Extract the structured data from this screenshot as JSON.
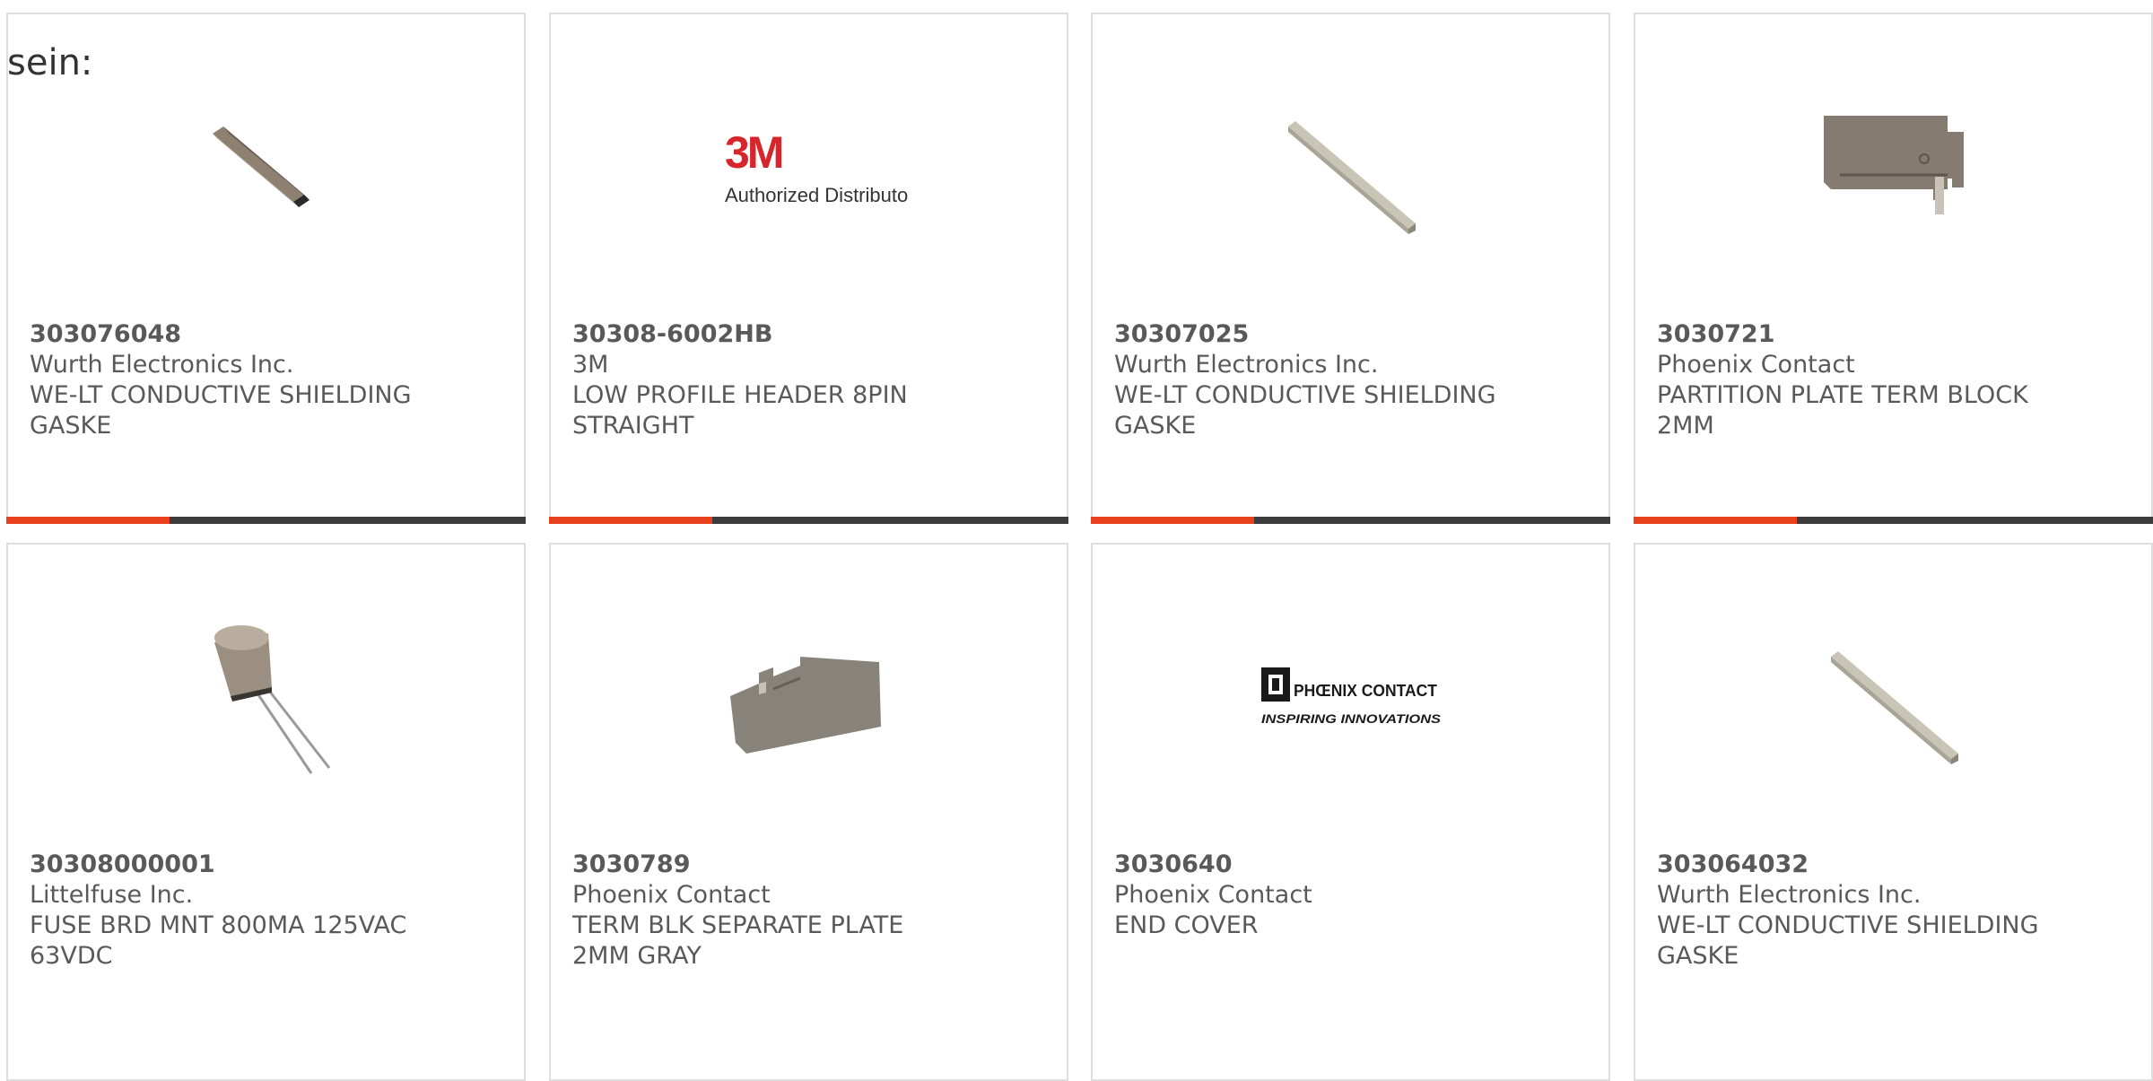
{
  "intro_text": "sein:",
  "products": [
    {
      "part_number": "303076048",
      "manufacturer": "Wurth Electronics Inc.",
      "description": "WE-LT CONDUCTIVE SHIELDING GASKE",
      "image": "gasket-block-image"
    },
    {
      "part_number": "30308-6002HB",
      "manufacturer": "3M",
      "description": "LOW PROFILE HEADER 8PIN STRAIGHT",
      "image": "3m-logo",
      "logo_text": "3M",
      "logo_subtext": "Authorized Distributor",
      "logo_color": "#d7262b"
    },
    {
      "part_number": "30307025",
      "manufacturer": "Wurth Electronics Inc.",
      "description": "WE-LT CONDUCTIVE SHIELDING GASKE",
      "image": "gasket-strip-image"
    },
    {
      "part_number": "3030721",
      "manufacturer": "Phoenix Contact",
      "description": "PARTITION PLATE TERM BLOCK 2MM",
      "image": "partition-plate-image"
    },
    {
      "part_number": "30308000001",
      "manufacturer": "Littelfuse Inc.",
      "description": "FUSE BRD MNT 800MA 125VAC 63VDC",
      "image": "fuse-image"
    },
    {
      "part_number": "3030789",
      "manufacturer": "Phoenix Contact",
      "description": "TERM BLK SEPARATE PLATE 2MM GRAY",
      "image": "separate-plate-image"
    },
    {
      "part_number": "3030640",
      "manufacturer": "Phoenix Contact",
      "description": "END COVER",
      "image": "phoenix-contact-logo",
      "logo_text": "PHŒNIX CONTACT",
      "logo_subtext": "INSPIRING INNOVATIONS"
    },
    {
      "part_number": "303064032",
      "manufacturer": "Wurth Electronics Inc.",
      "description": "WE-LT CONDUCTIVE SHIELDING GASKE",
      "image": "gasket-strip-image"
    }
  ],
  "colors": {
    "accent": "#e8401c",
    "bar_dark": "#3c3c3c",
    "card_border": "#dedede",
    "text": "#595959"
  }
}
